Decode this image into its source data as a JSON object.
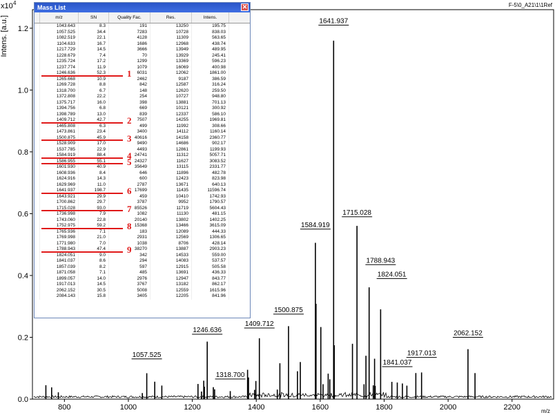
{
  "window": {
    "header_right": "F-5\\0_A21\\1\\1Ref"
  },
  "colors": {
    "marker": "#e01818",
    "title_bar": "#2a55c8",
    "trace": "#000000"
  },
  "mass_list": {
    "title": "Mass List",
    "close_icon": "close-icon",
    "columns": [
      "m/z",
      "SN",
      "Quality Fac.",
      "Res.",
      "Intens."
    ],
    "rows": [
      [
        "1043.643",
        "8.3",
        "191",
        "13250",
        "195.75"
      ],
      [
        "1057.525",
        "34.4",
        "7283",
        "10728",
        "838.03"
      ],
      [
        "1082.519",
        "22.1",
        "4128",
        "11309",
        "563.65"
      ],
      [
        "1104.633",
        "16.7",
        "1686",
        "12968",
        "438.74"
      ],
      [
        "1217.729",
        "14.5",
        "3666",
        "13949",
        "489.95"
      ],
      [
        "1228.679",
        "7.4",
        "70",
        "13929",
        "245.41"
      ],
      [
        "1235.724",
        "17.2",
        "1299",
        "13369",
        "596.23"
      ],
      [
        "1237.774",
        "11.9",
        "1079",
        "16069",
        "400.98"
      ],
      [
        "1246.636",
        "52.3",
        "6031",
        "12062",
        "1861.00"
      ],
      [
        "1265.668",
        "10.9",
        "2462",
        "9187",
        "386.59"
      ],
      [
        "1269.728",
        "8.8",
        "842",
        "12587",
        "316.24"
      ],
      [
        "1318.700",
        "6.7",
        "148",
        "12620",
        "259.50"
      ],
      [
        "1372.808",
        "22.2",
        "254",
        "10727",
        "948.80"
      ],
      [
        "1375.717",
        "16.0",
        "398",
        "13881",
        "701.13"
      ],
      [
        "1394.756",
        "6.8",
        "669",
        "10121",
        "300.92"
      ],
      [
        "1398.789",
        "13.0",
        "839",
        "12337",
        "586.10"
      ],
      [
        "1409.712",
        "42.7",
        "7507",
        "14255",
        "1969.81"
      ],
      [
        "1465.808",
        "6.3",
        "499",
        "11992",
        "308.66"
      ],
      [
        "1473.861",
        "23.4",
        "3400",
        "14112",
        "1160.14"
      ],
      [
        "1500.875",
        "45.9",
        "40616",
        "14158",
        "2360.77"
      ],
      [
        "1528.909",
        "17.0",
        "9490",
        "14686",
        "902.17"
      ],
      [
        "1537.785",
        "22.9",
        "4493",
        "12861",
        "1199.93"
      ],
      [
        "1584.919",
        "88.4",
        "24741",
        "11312",
        "5057.71"
      ],
      [
        "1586.955",
        "55.1",
        "24327",
        "11627",
        "3083.52"
      ],
      [
        "1601.930",
        "40.9",
        "35649",
        "13115",
        "2331.77"
      ],
      [
        "1608.936",
        "8.4",
        "646",
        "11896",
        "482.78"
      ],
      [
        "1624.916",
        "14.3",
        "600",
        "12423",
        "823.98"
      ],
      [
        "1629.969",
        "11.0",
        "2787",
        "13671",
        "640.13"
      ],
      [
        "1641.937",
        "198.7",
        "17699",
        "11435",
        "11596.74"
      ],
      [
        "1643.921",
        "29.9",
        "459",
        "10410",
        "1742.93"
      ],
      [
        "1700.862",
        "29.7",
        "3787",
        "9952",
        "1790.57"
      ],
      [
        "1715.028",
        "93.0",
        "85526",
        "11719",
        "5604.43"
      ],
      [
        "1736.998",
        "7.9",
        "1082",
        "11130",
        "481.15"
      ],
      [
        "1743.060",
        "22.8",
        "20140",
        "13802",
        "1402.25"
      ],
      [
        "1752.975",
        "59.2",
        "15368",
        "13466",
        "3615.09"
      ],
      [
        "1765.936",
        "7.1",
        "183",
        "12089",
        "444.33"
      ],
      [
        "1769.998",
        "21.0",
        "2931",
        "12569",
        "1306.65"
      ],
      [
        "1771.980",
        "7.0",
        "1038",
        "8706",
        "428.14"
      ],
      [
        "1788.943",
        "47.4",
        "38270",
        "13887",
        "2903.23"
      ],
      [
        "1824.051",
        "9.0",
        "342",
        "14533",
        "559.00"
      ],
      [
        "1841.037",
        "8.6",
        "294",
        "14083",
        "537.57"
      ],
      [
        "1857.039",
        "8.2",
        "597",
        "12915",
        "505.58"
      ],
      [
        "1871.058",
        "7.1",
        "485",
        "13691",
        "436.33"
      ],
      [
        "1899.057",
        "14.0",
        "2976",
        "12947",
        "843.77"
      ],
      [
        "1917.013",
        "14.5",
        "3767",
        "13182",
        "862.17"
      ],
      [
        "2062.152",
        "30.5",
        "5008",
        "12559",
        "1615.96"
      ],
      [
        "2084.143",
        "15.8",
        "3405",
        "12205",
        "841.96"
      ]
    ],
    "markers": [
      {
        "label": "1",
        "row": 8
      },
      {
        "label": "2",
        "row": 16
      },
      {
        "label": "3",
        "row": 19
      },
      {
        "label": "4",
        "row": 22
      },
      {
        "label": "5",
        "row": 23
      },
      {
        "label": "6",
        "row": 28
      },
      {
        "label": "7",
        "row": 31
      },
      {
        "label": "8",
        "row": 34
      },
      {
        "label": "9",
        "row": 38
      }
    ]
  },
  "chart_data": {
    "type": "line",
    "title": "",
    "xlabel": "m/z",
    "ylabel": "Intens. [a.u.]",
    "y_exponent_label": "x10",
    "y_exponent_power": "4",
    "xlim": [
      700,
      2330
    ],
    "ylim": [
      0,
      12600
    ],
    "x_ticks": [
      800,
      1000,
      1200,
      1400,
      1600,
      1800,
      2000,
      2200
    ],
    "x_tick_labels": [
      "800",
      "1000",
      "1200",
      "1400",
      "1600",
      "1800",
      "2000",
      "2200"
    ],
    "y_ticks": [
      0,
      2000,
      4000,
      6000,
      8000,
      10000,
      12000
    ],
    "y_tick_labels": [
      "0.0",
      "0.2",
      "0.4",
      "0.6",
      "0.8",
      "1.0",
      "1.2"
    ],
    "peaks": [
      {
        "x": 742,
        "y": 450
      },
      {
        "x": 760,
        "y": 380
      },
      {
        "x": 781,
        "y": 220
      },
      {
        "x": 1043.643,
        "y": 195.75
      },
      {
        "x": 1057.525,
        "y": 838.03
      },
      {
        "x": 1082.519,
        "y": 563.65
      },
      {
        "x": 1104.633,
        "y": 438.74
      },
      {
        "x": 1217.729,
        "y": 489.95
      },
      {
        "x": 1228.679,
        "y": 245.41
      },
      {
        "x": 1235.724,
        "y": 596.23
      },
      {
        "x": 1237.774,
        "y": 400.98
      },
      {
        "x": 1246.636,
        "y": 1861.0
      },
      {
        "x": 1265.668,
        "y": 386.59
      },
      {
        "x": 1269.728,
        "y": 316.24
      },
      {
        "x": 1318.7,
        "y": 259.5
      },
      {
        "x": 1372.808,
        "y": 948.8
      },
      {
        "x": 1375.717,
        "y": 701.13
      },
      {
        "x": 1394.756,
        "y": 300.92
      },
      {
        "x": 1398.789,
        "y": 586.1
      },
      {
        "x": 1409.712,
        "y": 1969.81
      },
      {
        "x": 1465.808,
        "y": 308.66
      },
      {
        "x": 1473.861,
        "y": 1160.14
      },
      {
        "x": 1500.875,
        "y": 2360.77
      },
      {
        "x": 1528.909,
        "y": 902.17
      },
      {
        "x": 1537.785,
        "y": 1199.93
      },
      {
        "x": 1584.919,
        "y": 5057.71
      },
      {
        "x": 1586.955,
        "y": 3083.52
      },
      {
        "x": 1601.93,
        "y": 2331.77
      },
      {
        "x": 1608.936,
        "y": 482.78
      },
      {
        "x": 1624.916,
        "y": 823.98
      },
      {
        "x": 1629.969,
        "y": 640.13
      },
      {
        "x": 1641.937,
        "y": 11596.74
      },
      {
        "x": 1643.921,
        "y": 1742.93
      },
      {
        "x": 1700.862,
        "y": 1790.57
      },
      {
        "x": 1715.028,
        "y": 5604.43
      },
      {
        "x": 1736.998,
        "y": 481.15
      },
      {
        "x": 1743.06,
        "y": 1402.25
      },
      {
        "x": 1752.975,
        "y": 3615.09
      },
      {
        "x": 1765.936,
        "y": 444.33
      },
      {
        "x": 1769.998,
        "y": 1306.65
      },
      {
        "x": 1771.98,
        "y": 428.14
      },
      {
        "x": 1788.943,
        "y": 2903.23
      },
      {
        "x": 1824.051,
        "y": 559.0
      },
      {
        "x": 1841.037,
        "y": 537.57
      },
      {
        "x": 1857.039,
        "y": 505.58
      },
      {
        "x": 1871.058,
        "y": 436.33
      },
      {
        "x": 1899.057,
        "y": 843.77
      },
      {
        "x": 1917.013,
        "y": 862.17
      },
      {
        "x": 2062.152,
        "y": 1615.96
      },
      {
        "x": 2084.143,
        "y": 841.96
      }
    ],
    "peak_labels": [
      {
        "text": "1057.525",
        "x": 1057.525,
        "y": 838.03
      },
      {
        "text": "1246.636",
        "x": 1246.636,
        "y": 1861.0
      },
      {
        "text": "1318.700",
        "x": 1318.7,
        "y": 259.5
      },
      {
        "text": "1409.712",
        "x": 1409.712,
        "y": 1969.81
      },
      {
        "text": "1500.875",
        "x": 1500.875,
        "y": 2360.77
      },
      {
        "text": "1584.919",
        "x": 1584.919,
        "y": 5057.71
      },
      {
        "text": "1641.937",
        "x": 1641.937,
        "y": 11596.74
      },
      {
        "text": "1715.028",
        "x": 1715.028,
        "y": 5604.43
      },
      {
        "text": "1788.943",
        "x": 1788.943,
        "y": 2903.23
      },
      {
        "text": "1824.051",
        "x": 1824.051,
        "y": 559.0
      },
      {
        "text": "1841.037",
        "x": 1841.037,
        "y": 537.57
      },
      {
        "text": "1917.013",
        "x": 1917.013,
        "y": 862.17
      },
      {
        "text": "2062.152",
        "x": 2062.152,
        "y": 1615.96
      }
    ],
    "peak_label_heights": {
      "1057.525": 1.3,
      "1246.636": 2.1,
      "1318.700": 0.65,
      "1409.712": 2.3,
      "1500.875": 2.75,
      "1584.919": 5.5,
      "1641.937": 12.1,
      "1715.028": 5.9,
      "1788.943": 4.35,
      "1824.051": 3.9,
      "1841.037": 1.05,
      "1917.013": 1.35,
      "2062.152": 2.0
    },
    "grid": false,
    "legend": "none"
  }
}
